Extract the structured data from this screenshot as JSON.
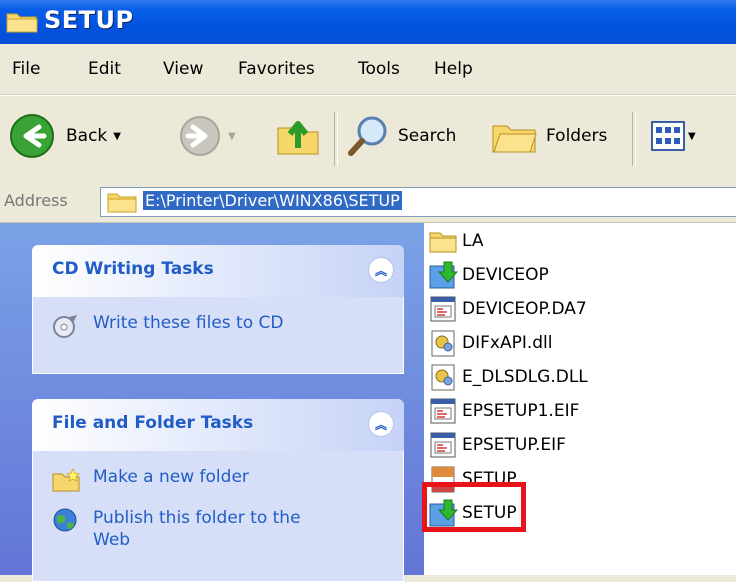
{
  "window": {
    "title": "SETUP"
  },
  "menu": [
    "File",
    "Edit",
    "View",
    "Favorites",
    "Tools",
    "Help"
  ],
  "toolbar": {
    "back": "Back",
    "search": "Search",
    "folders": "Folders"
  },
  "address": {
    "label": "Address",
    "path": "E:\\Printer\\Driver\\WINX86\\SETUP"
  },
  "cd_tasks": {
    "title": "CD Writing Tasks",
    "items": [
      "Write these files to CD"
    ]
  },
  "file_tasks": {
    "title": "File and Folder Tasks",
    "items": [
      "Make a new folder",
      "Publish this folder to the Web"
    ]
  },
  "files": [
    {
      "name": "LA",
      "icon": "folder-icon"
    },
    {
      "name": "DEVICEOP",
      "icon": "installer-icon"
    },
    {
      "name": "DEVICEOP.DA7",
      "icon": "data-file-icon"
    },
    {
      "name": "DIFxAPI.dll",
      "icon": "dll-icon"
    },
    {
      "name": "E_DLSDLG.DLL",
      "icon": "dll-icon"
    },
    {
      "name": "EPSETUP1.EIF",
      "icon": "data-file-icon"
    },
    {
      "name": "EPSETUP.EIF",
      "icon": "data-file-icon"
    },
    {
      "name": "SETUP",
      "icon": "ini-file-icon"
    },
    {
      "name": "SETUP",
      "icon": "installer-icon"
    }
  ],
  "colors": {
    "title_bar": "#0053E0",
    "task_pane": "#6375D6",
    "highlight": "#E8141A",
    "selection": "#316AC5"
  }
}
